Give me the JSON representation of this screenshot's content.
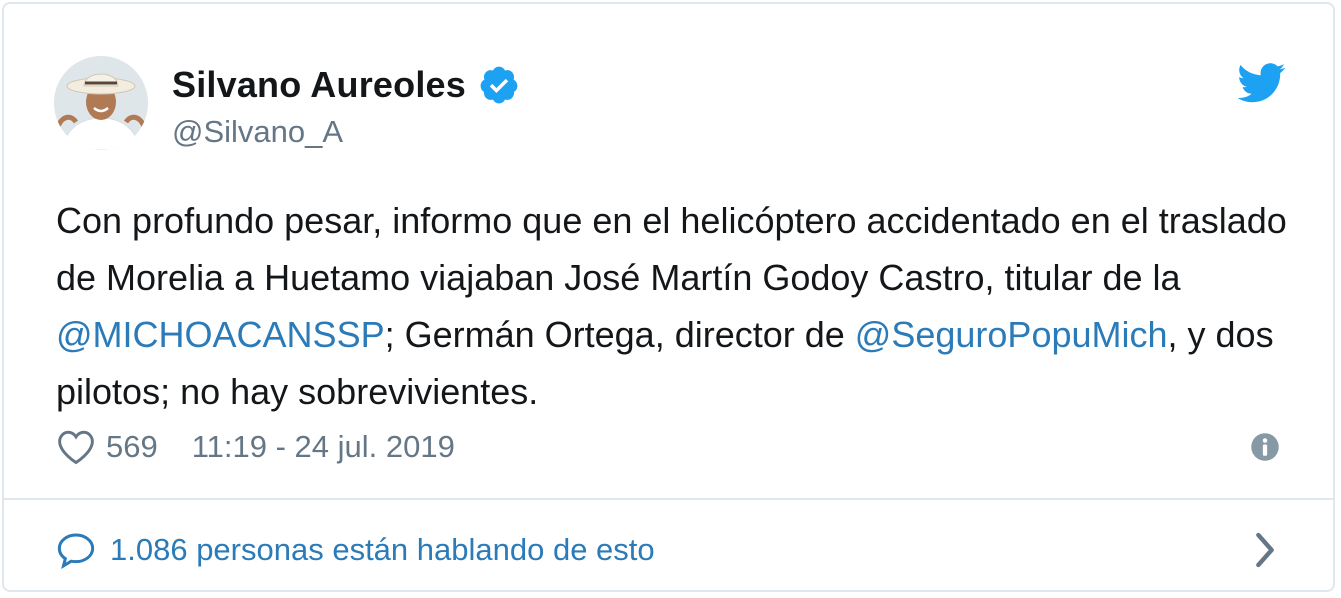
{
  "author": {
    "display_name": "Silvano Aureoles",
    "handle": "@Silvano_A",
    "verified": true
  },
  "tweet": {
    "segments": [
      {
        "text": "Con profundo pesar, informo que en el helicóptero accidentado en el traslado de Morelia a Huetamo viajaban José Martín Godoy Castro, titular de la ",
        "type": "text"
      },
      {
        "text": "@MICHOACANSSP",
        "type": "mention"
      },
      {
        "text": "; Germán Ortega, director de ",
        "type": "text"
      },
      {
        "text": "@SeguroPopuMich",
        "type": "mention"
      },
      {
        "text": ", y dos pilotos; no hay sobrevivientes.",
        "type": "text"
      }
    ]
  },
  "meta": {
    "like_count": "569",
    "timestamp": "11:19 - 24 jul. 2019"
  },
  "conversation": {
    "label": "1.086 personas están hablando de esto"
  },
  "icons": {
    "brand": "twitter-bird-icon",
    "verified": "verified-badge-icon",
    "like": "heart-icon",
    "info": "info-icon",
    "reply": "speech-bubble-icon",
    "chevron": "chevron-right-icon"
  },
  "colors": {
    "brand_blue": "#1da1f2",
    "link_blue": "#2b7bb9",
    "text": "#14171a",
    "muted": "#657786",
    "border": "#e1e8ed"
  }
}
